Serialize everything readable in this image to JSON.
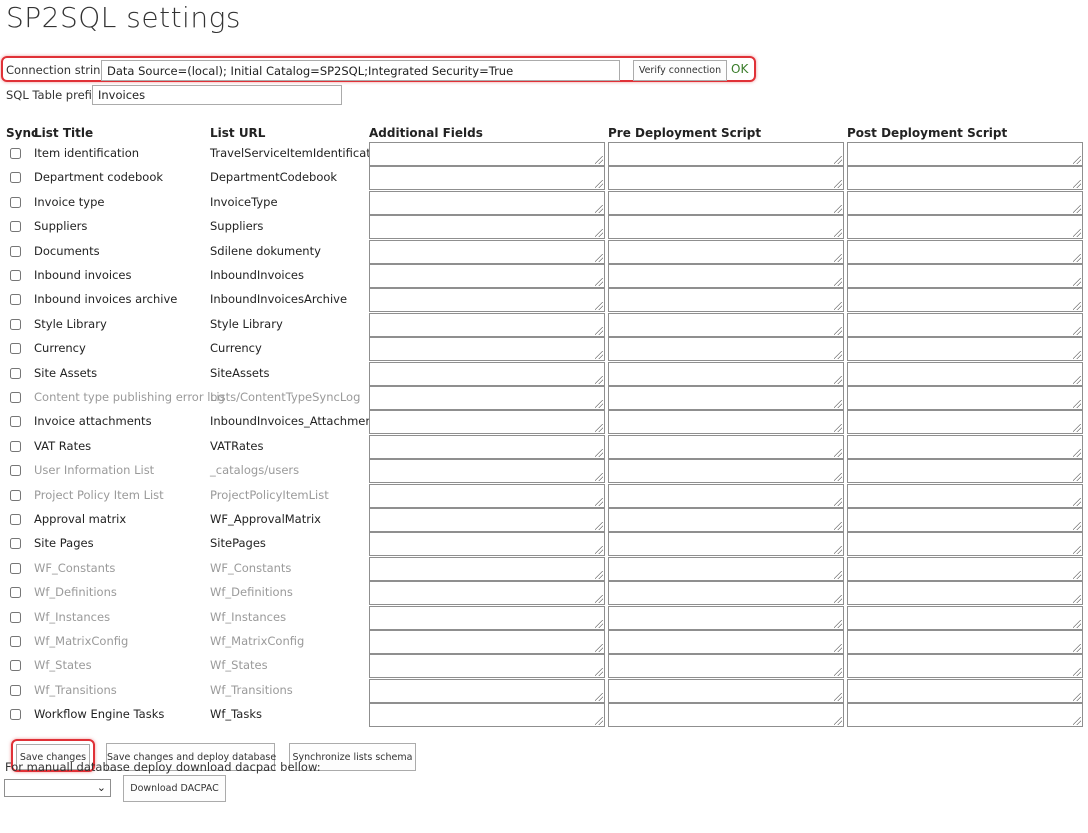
{
  "page": {
    "title": "SP2SQL settings"
  },
  "connection": {
    "label": "Connection string:",
    "value": "Data Source=(local); Initial Catalog=SP2SQL;Integrated Security=True",
    "verify_label": "Verify connection",
    "status": "OK"
  },
  "prefix": {
    "label": "SQL Table prefix:",
    "value": "Invoices"
  },
  "table": {
    "headers": {
      "sync": "Sync",
      "title": "List Title",
      "url": "List URL",
      "fields": "Additional Fields",
      "pre": "Pre Deployment Script",
      "post": "Post Deployment Script"
    },
    "rows": [
      {
        "title": "Item identification",
        "url": "TravelServiceItemIdentification",
        "disabled": false
      },
      {
        "title": "Department codebook",
        "url": "DepartmentCodebook",
        "disabled": false
      },
      {
        "title": "Invoice type",
        "url": "InvoiceType",
        "disabled": false
      },
      {
        "title": "Suppliers",
        "url": "Suppliers",
        "disabled": false
      },
      {
        "title": "Documents",
        "url": "Sdilene dokumenty",
        "disabled": false
      },
      {
        "title": "Inbound invoices",
        "url": "InboundInvoices",
        "disabled": false
      },
      {
        "title": "Inbound invoices archive",
        "url": "InboundInvoicesArchive",
        "disabled": false
      },
      {
        "title": "Style Library",
        "url": "Style Library",
        "disabled": false
      },
      {
        "title": "Currency",
        "url": "Currency",
        "disabled": false
      },
      {
        "title": "Site Assets",
        "url": "SiteAssets",
        "disabled": false
      },
      {
        "title": "Content type publishing error log",
        "url": "Lists/ContentTypeSyncLog",
        "disabled": true
      },
      {
        "title": "Invoice attachments",
        "url": "InboundInvoices_Attachments",
        "disabled": false
      },
      {
        "title": "VAT Rates",
        "url": "VATRates",
        "disabled": false
      },
      {
        "title": "User Information List",
        "url": "_catalogs/users",
        "disabled": true
      },
      {
        "title": "Project Policy Item List",
        "url": "ProjectPolicyItemList",
        "disabled": true
      },
      {
        "title": "Approval matrix",
        "url": "WF_ApprovalMatrix",
        "disabled": false
      },
      {
        "title": "Site Pages",
        "url": "SitePages",
        "disabled": false
      },
      {
        "title": "WF_Constants",
        "url": "WF_Constants",
        "disabled": true
      },
      {
        "title": "Wf_Definitions",
        "url": "Wf_Definitions",
        "disabled": true
      },
      {
        "title": "Wf_Instances",
        "url": "Wf_Instances",
        "disabled": true
      },
      {
        "title": "Wf_MatrixConfig",
        "url": "Wf_MatrixConfig",
        "disabled": true
      },
      {
        "title": "Wf_States",
        "url": "Wf_States",
        "disabled": true
      },
      {
        "title": "Wf_Transitions",
        "url": "Wf_Transitions",
        "disabled": true
      },
      {
        "title": "Workflow Engine Tasks",
        "url": "Wf_Tasks",
        "disabled": false
      }
    ]
  },
  "actions": {
    "save": "Save changes",
    "save_deploy": "Save changes and deploy database",
    "sync_schema": "Synchronize lists schema"
  },
  "dacpac": {
    "text": "For manuall database deploy download dacpac bellow:",
    "select_value": "",
    "download_label": "Download DACPAC"
  }
}
